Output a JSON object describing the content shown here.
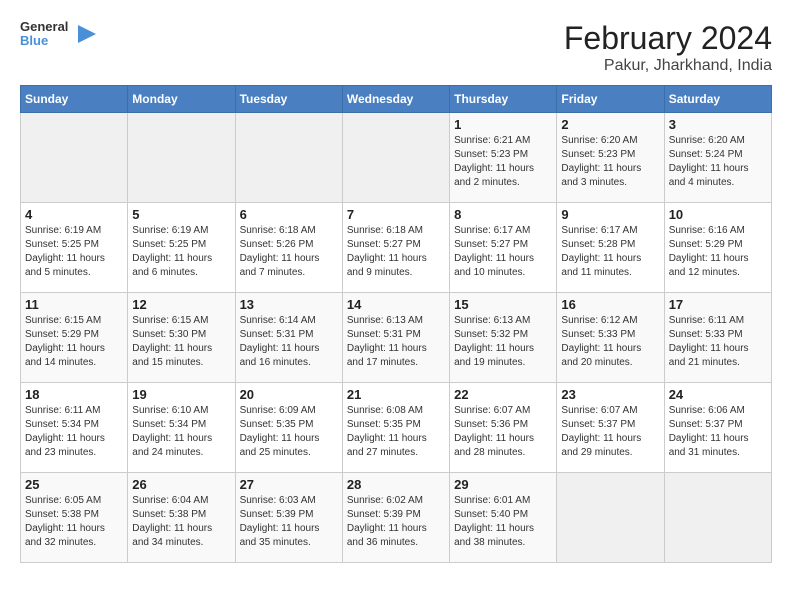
{
  "logo": {
    "text_general": "General",
    "text_blue": "Blue"
  },
  "title": "February 2024",
  "subtitle": "Pakur, Jharkhand, India",
  "headers": [
    "Sunday",
    "Monday",
    "Tuesday",
    "Wednesday",
    "Thursday",
    "Friday",
    "Saturday"
  ],
  "weeks": [
    [
      {
        "day": "",
        "info": ""
      },
      {
        "day": "",
        "info": ""
      },
      {
        "day": "",
        "info": ""
      },
      {
        "day": "",
        "info": ""
      },
      {
        "day": "1",
        "info": "Sunrise: 6:21 AM\nSunset: 5:23 PM\nDaylight: 11 hours and 2 minutes."
      },
      {
        "day": "2",
        "info": "Sunrise: 6:20 AM\nSunset: 5:23 PM\nDaylight: 11 hours and 3 minutes."
      },
      {
        "day": "3",
        "info": "Sunrise: 6:20 AM\nSunset: 5:24 PM\nDaylight: 11 hours and 4 minutes."
      }
    ],
    [
      {
        "day": "4",
        "info": "Sunrise: 6:19 AM\nSunset: 5:25 PM\nDaylight: 11 hours and 5 minutes."
      },
      {
        "day": "5",
        "info": "Sunrise: 6:19 AM\nSunset: 5:25 PM\nDaylight: 11 hours and 6 minutes."
      },
      {
        "day": "6",
        "info": "Sunrise: 6:18 AM\nSunset: 5:26 PM\nDaylight: 11 hours and 7 minutes."
      },
      {
        "day": "7",
        "info": "Sunrise: 6:18 AM\nSunset: 5:27 PM\nDaylight: 11 hours and 9 minutes."
      },
      {
        "day": "8",
        "info": "Sunrise: 6:17 AM\nSunset: 5:27 PM\nDaylight: 11 hours and 10 minutes."
      },
      {
        "day": "9",
        "info": "Sunrise: 6:17 AM\nSunset: 5:28 PM\nDaylight: 11 hours and 11 minutes."
      },
      {
        "day": "10",
        "info": "Sunrise: 6:16 AM\nSunset: 5:29 PM\nDaylight: 11 hours and 12 minutes."
      }
    ],
    [
      {
        "day": "11",
        "info": "Sunrise: 6:15 AM\nSunset: 5:29 PM\nDaylight: 11 hours and 14 minutes."
      },
      {
        "day": "12",
        "info": "Sunrise: 6:15 AM\nSunset: 5:30 PM\nDaylight: 11 hours and 15 minutes."
      },
      {
        "day": "13",
        "info": "Sunrise: 6:14 AM\nSunset: 5:31 PM\nDaylight: 11 hours and 16 minutes."
      },
      {
        "day": "14",
        "info": "Sunrise: 6:13 AM\nSunset: 5:31 PM\nDaylight: 11 hours and 17 minutes."
      },
      {
        "day": "15",
        "info": "Sunrise: 6:13 AM\nSunset: 5:32 PM\nDaylight: 11 hours and 19 minutes."
      },
      {
        "day": "16",
        "info": "Sunrise: 6:12 AM\nSunset: 5:33 PM\nDaylight: 11 hours and 20 minutes."
      },
      {
        "day": "17",
        "info": "Sunrise: 6:11 AM\nSunset: 5:33 PM\nDaylight: 11 hours and 21 minutes."
      }
    ],
    [
      {
        "day": "18",
        "info": "Sunrise: 6:11 AM\nSunset: 5:34 PM\nDaylight: 11 hours and 23 minutes."
      },
      {
        "day": "19",
        "info": "Sunrise: 6:10 AM\nSunset: 5:34 PM\nDaylight: 11 hours and 24 minutes."
      },
      {
        "day": "20",
        "info": "Sunrise: 6:09 AM\nSunset: 5:35 PM\nDaylight: 11 hours and 25 minutes."
      },
      {
        "day": "21",
        "info": "Sunrise: 6:08 AM\nSunset: 5:35 PM\nDaylight: 11 hours and 27 minutes."
      },
      {
        "day": "22",
        "info": "Sunrise: 6:07 AM\nSunset: 5:36 PM\nDaylight: 11 hours and 28 minutes."
      },
      {
        "day": "23",
        "info": "Sunrise: 6:07 AM\nSunset: 5:37 PM\nDaylight: 11 hours and 29 minutes."
      },
      {
        "day": "24",
        "info": "Sunrise: 6:06 AM\nSunset: 5:37 PM\nDaylight: 11 hours and 31 minutes."
      }
    ],
    [
      {
        "day": "25",
        "info": "Sunrise: 6:05 AM\nSunset: 5:38 PM\nDaylight: 11 hours and 32 minutes."
      },
      {
        "day": "26",
        "info": "Sunrise: 6:04 AM\nSunset: 5:38 PM\nDaylight: 11 hours and 34 minutes."
      },
      {
        "day": "27",
        "info": "Sunrise: 6:03 AM\nSunset: 5:39 PM\nDaylight: 11 hours and 35 minutes."
      },
      {
        "day": "28",
        "info": "Sunrise: 6:02 AM\nSunset: 5:39 PM\nDaylight: 11 hours and 36 minutes."
      },
      {
        "day": "29",
        "info": "Sunrise: 6:01 AM\nSunset: 5:40 PM\nDaylight: 11 hours and 38 minutes."
      },
      {
        "day": "",
        "info": ""
      },
      {
        "day": "",
        "info": ""
      }
    ]
  ]
}
